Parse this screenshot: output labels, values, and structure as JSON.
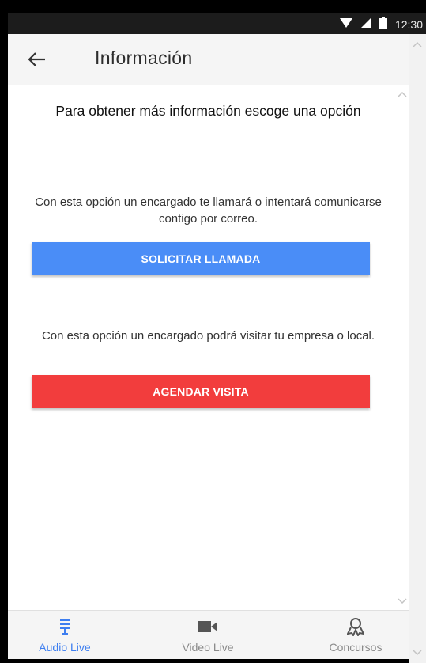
{
  "status_bar": {
    "time": "12:30",
    "icons": [
      "wifi-icon",
      "signal-icon",
      "battery-icon"
    ]
  },
  "app_bar": {
    "title": "Información",
    "back_icon": "arrow-back-icon"
  },
  "content": {
    "heading": "Para obtener más información escoge una opción",
    "call_description": "Con esta opción un encargado te llamará o intentará comunicarse contigo por correo.",
    "call_button": "SOLICITAR LLAMADA",
    "visit_description": "Con esta opción un encargado podrá visitar tu empresa o local.",
    "visit_button": "AGENDAR VISITA"
  },
  "bottom_nav": {
    "items": [
      {
        "label": "Audio Live",
        "icon": "microphone-icon",
        "active": true
      },
      {
        "label": "Video Live",
        "icon": "videocam-icon",
        "active": false
      },
      {
        "label": "Concursos",
        "icon": "award-icon",
        "active": false
      }
    ]
  },
  "colors": {
    "primary_button": "#4a8df7",
    "danger_button": "#f23d3d",
    "active_tab": "#3d7ef0",
    "inactive_tab": "#8a8a8a"
  }
}
